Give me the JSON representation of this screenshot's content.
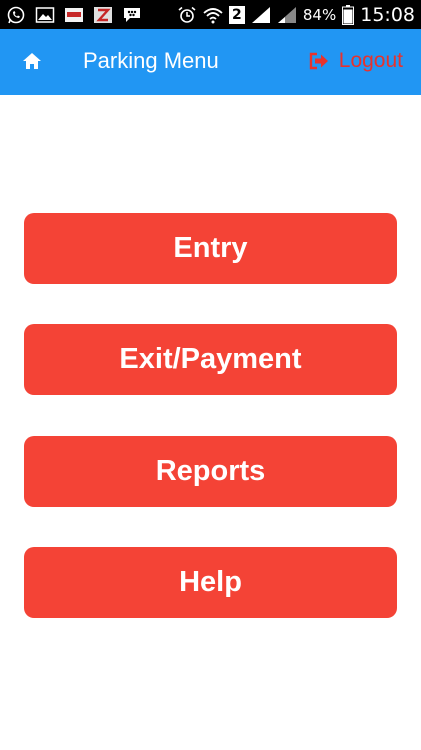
{
  "status_bar": {
    "battery_percent": "84%",
    "time": "15:08",
    "sim_badge": "2",
    "icons": [
      "whatsapp-icon",
      "image-icon",
      "purch-app-icon",
      "zing-app-icon",
      "bbm-icon",
      "alarm-icon",
      "wifi-icon",
      "signal-icon",
      "signal-2-icon",
      "battery-icon"
    ]
  },
  "appbar": {
    "title": "Parking Menu",
    "logout_label": "Logout",
    "home_icon": "home-icon",
    "logout_icon": "logout-icon",
    "background_color": "#2196f3",
    "logout_color": "#e8322d"
  },
  "menu": {
    "button_color": "#f44336",
    "items": [
      {
        "label": "Entry"
      },
      {
        "label": "Exit/Payment"
      },
      {
        "label": "Reports"
      },
      {
        "label": "Help"
      }
    ]
  }
}
